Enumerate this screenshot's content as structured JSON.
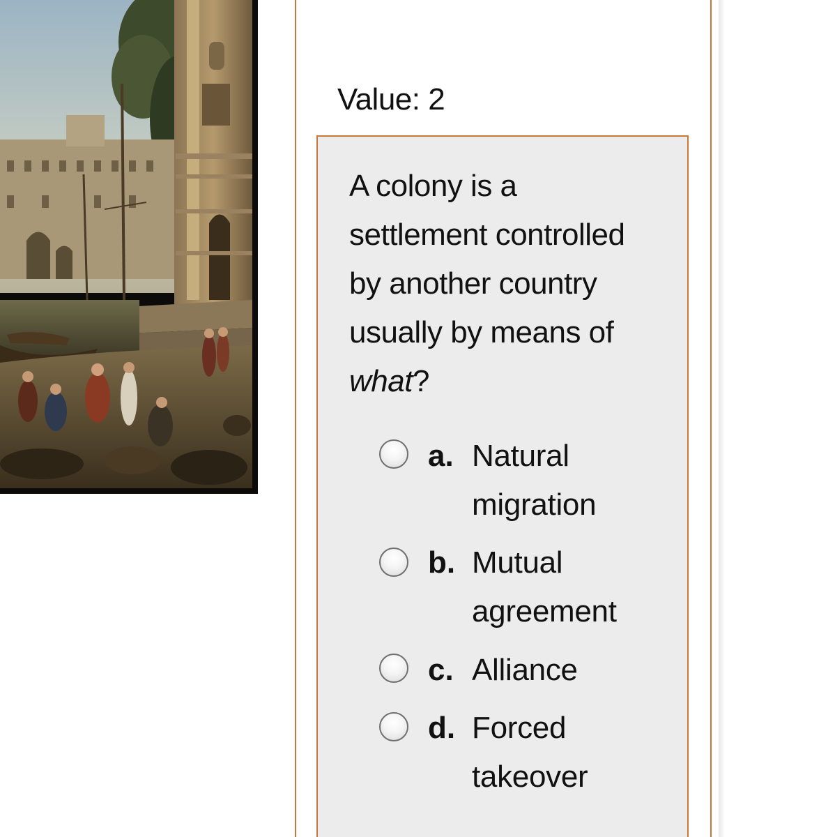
{
  "question": {
    "value_label": "Value: 2",
    "stem_lines": [
      "A colony is a",
      "settlement controlled",
      "by another country",
      "usually by means of"
    ],
    "stem_italic_word": "what",
    "stem_end_punct": "?",
    "options": [
      {
        "letter": "a.",
        "lines": [
          "Natural",
          "migration"
        ]
      },
      {
        "letter": "b.",
        "lines": [
          "Mutual",
          "agreement"
        ]
      },
      {
        "letter": "c.",
        "lines": [
          "Alliance"
        ]
      },
      {
        "letter": "d.",
        "lines": [
          "Forced",
          "takeover"
        ]
      }
    ]
  },
  "colors": {
    "panel_border": "#c8783a",
    "question_bg": "#ececec",
    "text": "#111111"
  },
  "icons": {
    "radio": "radio-button-unselected-icon"
  }
}
